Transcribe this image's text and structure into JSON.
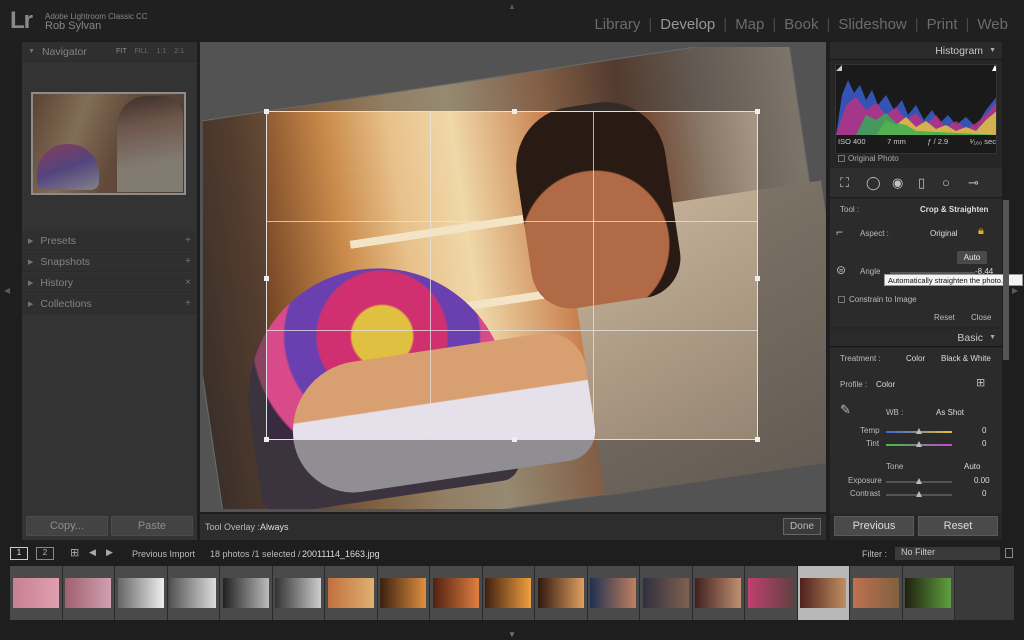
{
  "app": {
    "logo": "Lr",
    "name": "Adobe Lightroom Classic CC",
    "user": "Rob Sylvan"
  },
  "modules": [
    "Library",
    "Develop",
    "Map",
    "Book",
    "Slideshow",
    "Print",
    "Web"
  ],
  "active_module": "Develop",
  "left_panel": {
    "navigator": {
      "title": "Navigator",
      "opts": [
        "FIT",
        "FILL",
        "1:1",
        "2:1"
      ]
    },
    "sections": [
      {
        "title": "Presets",
        "action": "+"
      },
      {
        "title": "Snapshots",
        "action": "+"
      },
      {
        "title": "History",
        "action": "×"
      },
      {
        "title": "Collections",
        "action": "+"
      }
    ],
    "copy_label": "Copy...",
    "paste_label": "Paste"
  },
  "toolbar": {
    "overlay_label": "Tool Overlay :",
    "overlay_value": "Always",
    "done_label": "Done"
  },
  "right_panel": {
    "histogram_title": "Histogram",
    "info": {
      "iso": "ISO 400",
      "focal": "7 mm",
      "aperture": "ƒ / 2.9",
      "shutter": "¹⁄₁₆₀ sec"
    },
    "original_photo": "Original Photo",
    "crop": {
      "tool_label": "Tool :",
      "tool_value": "Crop & Straighten",
      "aspect_label": "Aspect :",
      "aspect_value": "Original",
      "auto_label": "Auto",
      "angle_label": "Angle",
      "angle_value": "-8.44",
      "constrain_label": "Constrain to Image",
      "reset_label": "Reset",
      "close_label": "Close",
      "tooltip": "Automatically straighten the photo."
    },
    "basic": {
      "title": "Basic",
      "treatment_label": "Treatment :",
      "color": "Color",
      "bw": "Black & White",
      "profile_label": "Profile :",
      "profile_value": "Color",
      "wb_label": "WB :",
      "wb_value": "As Shot",
      "temp_label": "Temp",
      "temp_value": "0",
      "tint_label": "Tint",
      "tint_value": "0",
      "tone_label": "Tone",
      "tone_auto": "Auto",
      "exposure_label": "Exposure",
      "exposure_value": "0.00",
      "contrast_label": "Contrast",
      "contrast_value": "0"
    },
    "previous_label": "Previous",
    "reset_label": "Reset"
  },
  "filmstrip_bar": {
    "view1": "1",
    "view2": "2",
    "source": "Previous Import",
    "count": "18 photos /1 selected /",
    "filename": "20011114_1663.jpg",
    "filter_label": "Filter :",
    "filter_value": "No Filter"
  },
  "filmstrip_count": 18,
  "selected_index": 15,
  "colors": {
    "accent": "#eeeeee",
    "panel": "#262626"
  }
}
